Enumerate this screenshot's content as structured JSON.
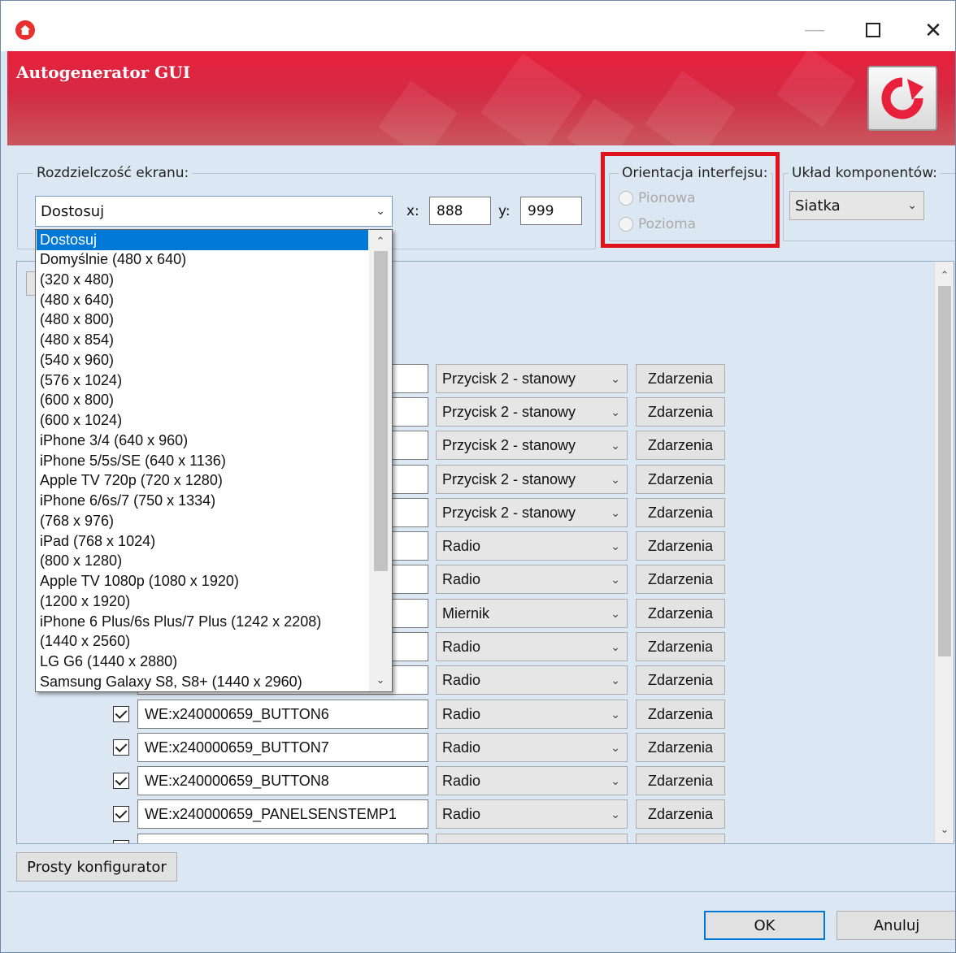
{
  "window": {
    "minimize": "—",
    "close": "✕"
  },
  "header": {
    "title": "Autogenerator GUI",
    "refresh_icon": "refresh-icon"
  },
  "resolution": {
    "label": "Rozdzielczość ekranu:",
    "selected": "Dostosuj",
    "x_label": "x:",
    "x_value": "888",
    "y_label": "y:",
    "y_value": "999",
    "options": [
      "Dostosuj",
      "Domyślnie  (480 x 640)",
      "  (320 x 480)",
      "  (480 x 640)",
      "  (480 x 800)",
      "  (480 x 854)",
      "  (540 x 960)",
      "  (576 x 1024)",
      "  (600 x 800)",
      "  (600 x 1024)",
      "iPhone 3/4  (640 x 960)",
      "iPhone 5/5s/SE  (640 x 1136)",
      "Apple TV 720p  (720 x 1280)",
      "iPhone 6/6s/7  (750 x 1334)",
      "  (768 x 976)",
      " iPad  (768 x 1024)",
      "  (800 x 1280)",
      "Apple TV 1080p  (1080 x 1920)",
      "  (1200 x 1920)",
      "iPhone 6 Plus/6s Plus/7 Plus  (1242 x 2208)",
      "  (1440 x 2560)",
      "LG G6  (1440 x 2880)",
      "Samsung Galaxy S8, S8+  (1440 x 2960)"
    ]
  },
  "orientation": {
    "label": "Orientacja interfejsu:",
    "options": [
      "Pionowa",
      "Pozioma"
    ]
  },
  "layout": {
    "label": "Układ komponentów:",
    "selected": "Siatka"
  },
  "components": {
    "events_label": "Zdarzenia",
    "rows": [
      {
        "name": "",
        "type": "Przycisk 2 - stanowy"
      },
      {
        "name": "",
        "type": "Przycisk 2 - stanowy"
      },
      {
        "name": "",
        "type": "Przycisk 2 - stanowy"
      },
      {
        "name": "",
        "type": "Przycisk 2 - stanowy"
      },
      {
        "name": "",
        "type": "Przycisk 2 - stanowy"
      },
      {
        "name": "",
        "type": "Radio"
      },
      {
        "name": "",
        "type": "Radio"
      },
      {
        "name": "",
        "type": "Miernik"
      },
      {
        "name": "",
        "type": "Radio"
      },
      {
        "name": "",
        "type": "Radio"
      },
      {
        "name": "WE:x240000659_BUTTON6",
        "type": "Radio"
      },
      {
        "name": "WE:x240000659_BUTTON7",
        "type": "Radio"
      },
      {
        "name": "WE:x240000659_BUTTON8",
        "type": "Radio"
      },
      {
        "name": "WE:x240000659_PANELSENSTEMP1",
        "type": "Radio"
      }
    ]
  },
  "footer": {
    "simple_config": "Prosty konfigurator",
    "ok": "OK",
    "cancel": "Anuluj"
  },
  "colors": {
    "accent": "#e8203c",
    "highlight": "#e0131c",
    "selection": "#0078d7"
  }
}
